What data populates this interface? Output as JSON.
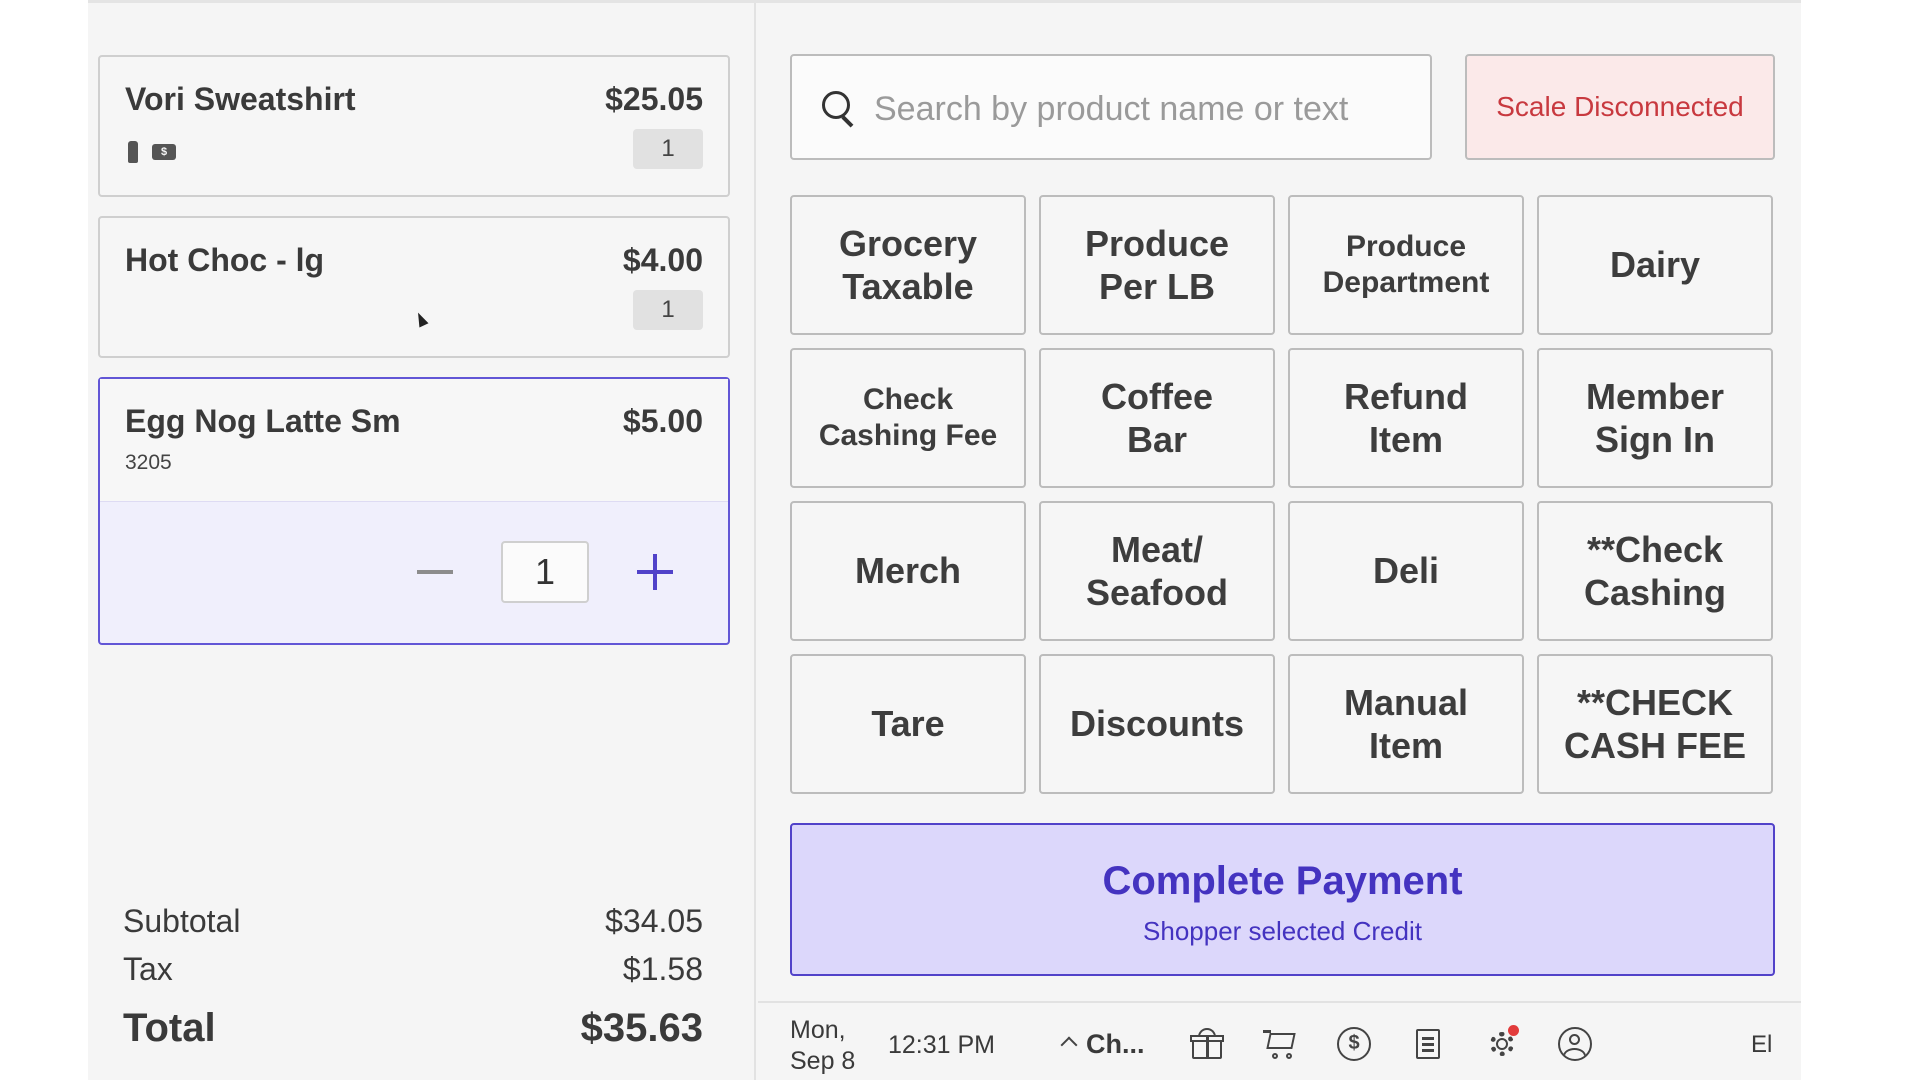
{
  "cart": {
    "items": [
      {
        "name": "Vori Sweatshirt",
        "price": "$25.05",
        "qty": "1",
        "icons": [
          "bottle-icon",
          "dollar-tag-icon"
        ],
        "icon_tag_text": "$"
      },
      {
        "name": "Hot Choc - lg",
        "price": "$4.00",
        "qty": "1"
      },
      {
        "name": "Egg Nog Latte Sm",
        "price": "$5.00",
        "sku": "3205",
        "qty": "1",
        "selected": true
      }
    ],
    "totals": {
      "subtotal_label": "Subtotal",
      "subtotal": "$34.05",
      "tax_label": "Tax",
      "tax": "$1.58",
      "total_label": "Total",
      "total": "$35.63"
    }
  },
  "search": {
    "placeholder": "Search by product name or text",
    "value": ""
  },
  "scale_status": {
    "label": "Scale Disconnected",
    "color": "#c8393f",
    "background": "#fbe9e9"
  },
  "tiles": [
    "Grocery\nTaxable",
    "Produce\nPer LB",
    "Produce\nDepartment",
    "Dairy",
    "Check\nCashing Fee",
    "Coffee\nBar",
    "Refund\nItem",
    "Member\nSign In",
    "Merch",
    "Meat/\nSeafood",
    "Deli",
    "**Check\nCashing",
    "Tare",
    "Discounts",
    "Manual\nItem",
    "**CHECK\nCASH FEE"
  ],
  "payment": {
    "title": "Complete Payment",
    "subtitle": "Shopper selected Credit",
    "accent": "#4433c0"
  },
  "taskbar": {
    "date_line1": "Mon,",
    "date_line2": "Sep 8",
    "time": "12:31 PM",
    "chooser_label": "Ch...",
    "icons": [
      "gift-icon",
      "cart-icon",
      "dollar-circle-icon",
      "receipt-icon",
      "gear-icon",
      "user-icon"
    ],
    "dollar_glyph": "$",
    "user_initials": "El"
  }
}
